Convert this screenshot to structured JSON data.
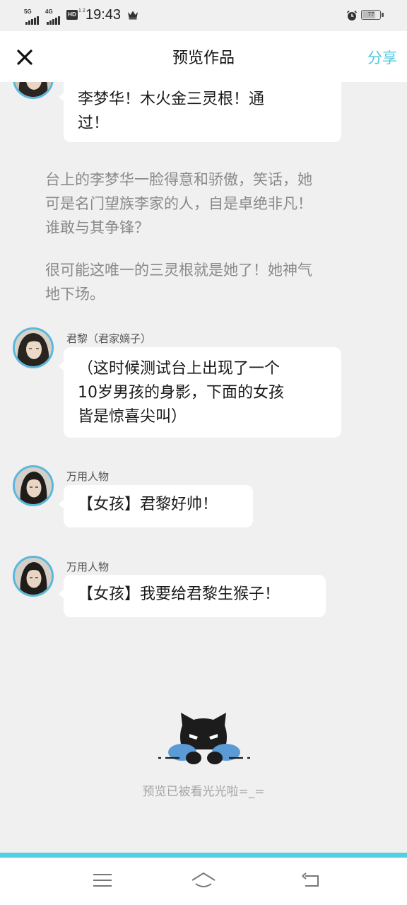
{
  "status_bar": {
    "net1": "5G",
    "net2": "4G",
    "hd": "HD",
    "hd_sub": "1 2",
    "time": "19:43",
    "battery": "77",
    "battery_level": 0.77,
    "icons": [
      "signal-5g-icon",
      "signal-4g-icon",
      "hd-icon",
      "crown-icon",
      "alarm-icon",
      "battery-icon"
    ]
  },
  "header": {
    "close_icon": "close-icon",
    "title": "预览作品",
    "share_label": "分享",
    "accent_color": "#4fc8dd"
  },
  "messages": {
    "m0": {
      "line1": "李梦华！木火金三灵根！通",
      "line2": "过！"
    },
    "narr1": {
      "line1": "台上的李梦华一脸得意和骄傲，笑话，她",
      "line2": "可是名门望族李家的人，自是卓绝非凡！",
      "line3": "谁敢与其争锋？"
    },
    "narr2": {
      "line1": "很可能这唯一的三灵根就是她了！她神气",
      "line2": "地下场。"
    },
    "m1": {
      "speaker": "君黎（君家嫡子）",
      "line1": "（这时候测试台上出现了一个",
      "line2": "10岁男孩的身影，下面的女孩",
      "line3": "皆是惊喜尖叫）"
    },
    "m2": {
      "speaker": "万用人物",
      "text": "【女孩】君黎好帅！"
    },
    "m3": {
      "speaker": "万用人物",
      "text": "【女孩】我要给君黎生猴子！"
    }
  },
  "end": {
    "text": "预览已被看光光啦=_=",
    "mascot_icon": "peeking-cat-mascot-icon"
  },
  "nav": {
    "icons": [
      "menu-icon",
      "home-icon",
      "back-icon"
    ],
    "accent_color": "#4fd1e2"
  }
}
